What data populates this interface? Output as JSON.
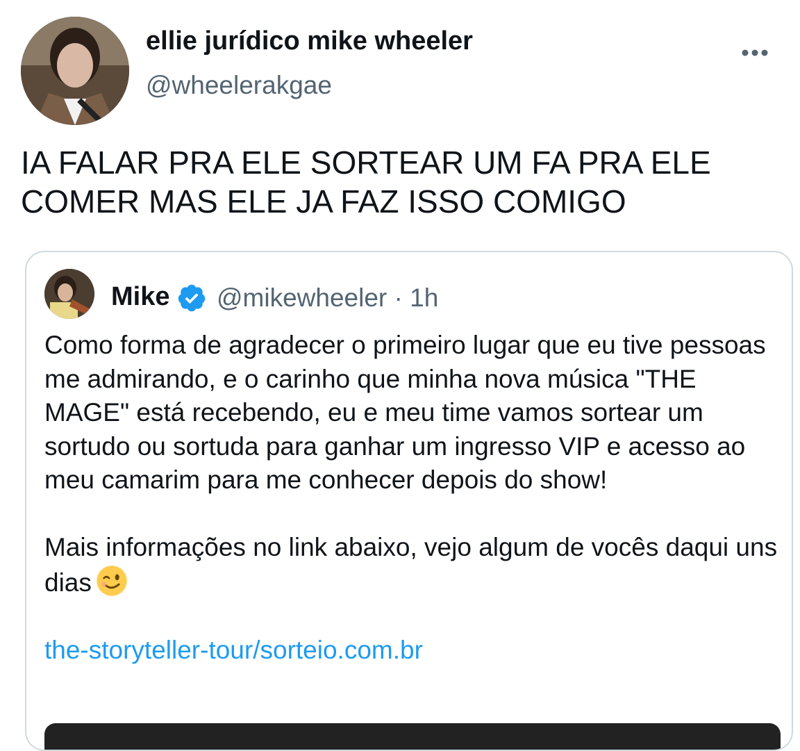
{
  "tweet": {
    "display_name": "ellie jurídico mike wheeler",
    "handle": "@wheelerakgae",
    "avatar_icon": "profile-avatar",
    "more_icon": "more-options-icon",
    "text": "IA FALAR PRA ELE SORTEAR UM FA PRA ELE\nCOMER MAS ELE JA FAZ ISSO COMIGO"
  },
  "quote": {
    "display_name": "Mike",
    "verified_icon": "verified-badge-icon",
    "meta": "@mikewheeler · 1h",
    "paragraph1": "Como forma de agradecer o primeiro lugar que eu tive pessoas me admirando, e o carinho que minha nova música \"THE MAGE\" está recebendo, eu e meu time vamos sortear um sortudo ou sortuda para ganhar um ingresso VIP e acesso ao meu camarim para me conhecer depois do show!",
    "paragraph2": "Mais informações no link abaixo, vejo algum de vocês daqui uns dias",
    "emoji_icon": "winking-face-emoji",
    "link": "the-storyteller-tour/sorteio.com.br"
  },
  "colors": {
    "text": "#0f1419",
    "secondary": "#536471",
    "link": "#1d9bf0",
    "border": "#cfd9de"
  }
}
